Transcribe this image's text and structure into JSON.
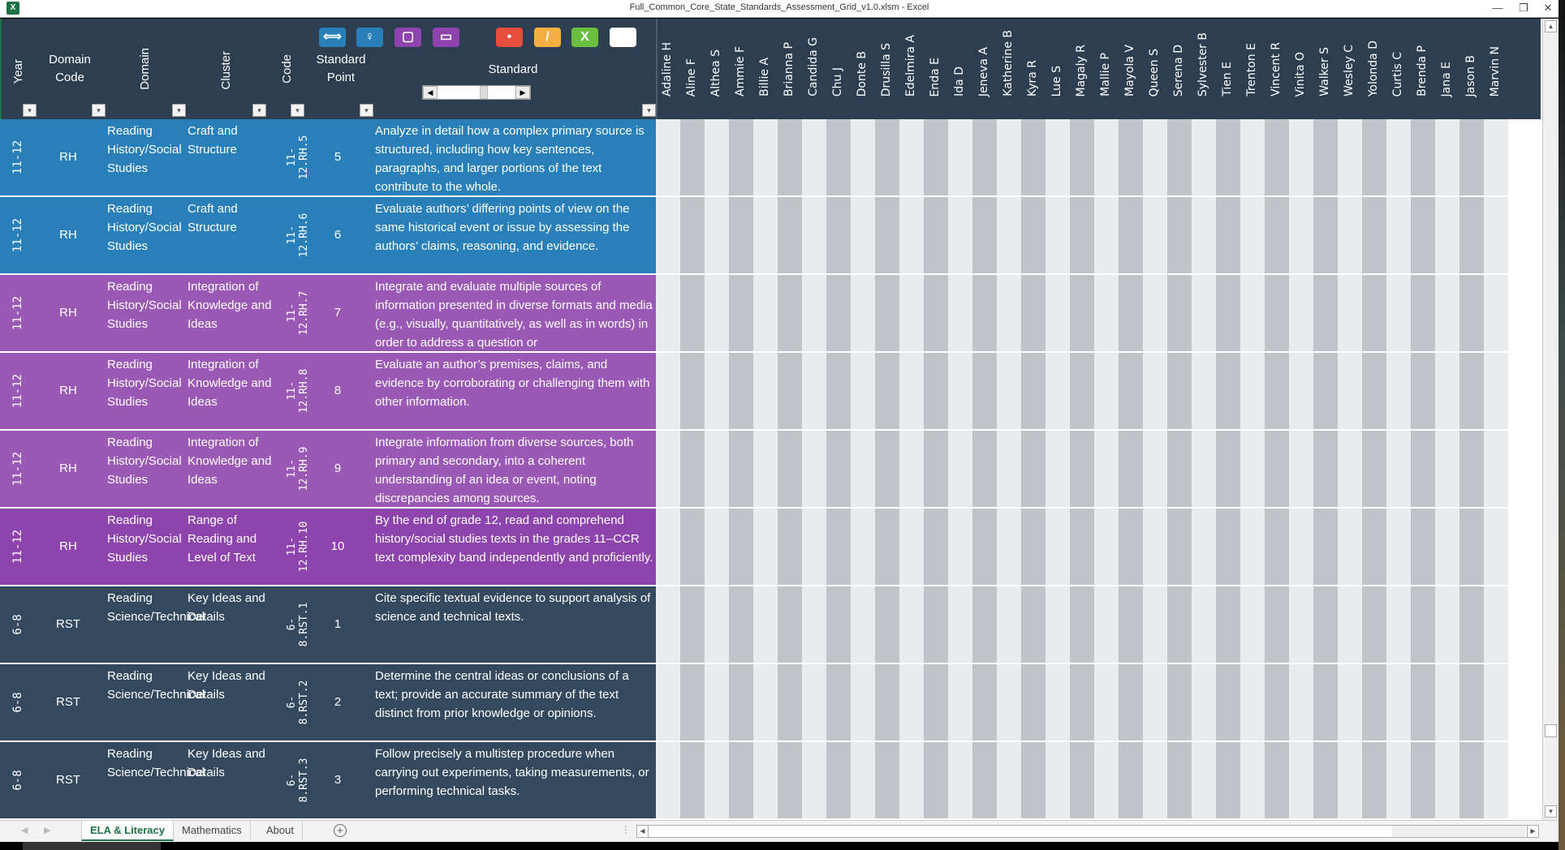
{
  "window": {
    "app_icon": "excel-icon",
    "title": "Full_Common_Core_State_Standards_Assessment_Grid_v1.0.xlsm - Excel",
    "minimize": "—",
    "restore": "❐",
    "close": "✕"
  },
  "header": {
    "year": "Year",
    "domain_code_line1": "Domain",
    "domain_code_line2": "Code",
    "domain": "Domain",
    "cluster": "Cluster",
    "code": "Code",
    "standard_point_line1": "Standard",
    "standard_point_line2": "Point",
    "standard": "Standard",
    "filter_glyph": "▾",
    "toolbar": [
      {
        "name": "expand-columns-icon",
        "glyph": "⟺",
        "color": "#2980b9"
      },
      {
        "name": "key-icon",
        "glyph": "♀",
        "color": "#2980b9"
      },
      {
        "name": "rounded-square-icon",
        "glyph": "▢",
        "color": "#8e44ad"
      },
      {
        "name": "window-icon",
        "glyph": "▭",
        "color": "#8e44ad"
      },
      {
        "name": "dot-mark-icon",
        "glyph": "•",
        "color": "#e74c3c"
      },
      {
        "name": "slash-mark-icon",
        "glyph": "/",
        "color": "#f5b041"
      },
      {
        "name": "x-mark-icon",
        "glyph": "X",
        "color": "#6abf40"
      },
      {
        "name": "blank-mark-icon",
        "glyph": "",
        "color": "#ffffff"
      }
    ],
    "scroll_left": "◀",
    "scroll_right": "▶"
  },
  "students": [
    "Adaline H",
    "Aline F",
    "Althea S",
    "Ammie F",
    "Billie A",
    "Brianna P",
    "Candida G",
    "Chu J",
    "Donte B",
    "Drusilla S",
    "Edelmira A",
    "Enda E",
    "Ida D",
    "Jeneva A",
    "Katherine B",
    "Kyra R",
    "Lue S",
    "Magaly R",
    "Mallie P",
    "Mayola V",
    "Queen S",
    "Serena D",
    "Sylvester B",
    "Tien E",
    "Trenton E",
    "Vincent R",
    "Vinita O",
    "Walker S",
    "Wesley C",
    "Yolonda D",
    "Curtis C",
    "Brenda P",
    "Jana E",
    "Jason B",
    "Marvin N"
  ],
  "rows": [
    {
      "year": "11-12",
      "domain_code": "RH",
      "domain": "Reading History/Social Studies",
      "cluster": "Craft and Structure",
      "code": "11-12.RH.5",
      "point": "5",
      "standard": "Analyze in detail how a complex primary source is structured, including how key sentences, paragraphs, and larger portions of the text contribute to the whole.",
      "color": "blue"
    },
    {
      "year": "11-12",
      "domain_code": "RH",
      "domain": "Reading History/Social Studies",
      "cluster": "Craft and Structure",
      "code": "11-12.RH.6",
      "point": "6",
      "standard": "Evaluate authors’ differing points of view on the same historical event or issue by assessing the authors’ claims, reasoning, and evidence.",
      "color": "blue"
    },
    {
      "year": "11-12",
      "domain_code": "RH",
      "domain": "Reading History/Social Studies",
      "cluster": "Integration of Knowledge and Ideas",
      "code": "11-12.RH.7",
      "point": "7",
      "standard": "Integrate and evaluate multiple sources of information presented in diverse formats and media (e.g., visually, quantitatively, as well as in words) in order to address a question or",
      "color": "purple1"
    },
    {
      "year": "11-12",
      "domain_code": "RH",
      "domain": "Reading History/Social Studies",
      "cluster": "Integration of Knowledge and Ideas",
      "code": "11-12.RH.8",
      "point": "8",
      "standard": "Evaluate an author’s premises, claims, and evidence by corroborating or challenging them with other information.",
      "color": "purple1"
    },
    {
      "year": "11-12",
      "domain_code": "RH",
      "domain": "Reading History/Social Studies",
      "cluster": "Integration of Knowledge and Ideas",
      "code": "11-12.RH.9",
      "point": "9",
      "standard": "Integrate information from diverse sources, both primary and secondary, into a coherent understanding of an idea or event, noting discrepancies among sources.",
      "color": "purple1"
    },
    {
      "year": "11-12",
      "domain_code": "RH",
      "domain": "Reading History/Social Studies",
      "cluster": "Range of Reading and Level of Text",
      "code": "11-12.RH.10",
      "point": "10",
      "standard": "By the end of grade 12, read and comprehend history/social studies texts in the grades 11–CCR text complexity band independently and proficiently.",
      "color": "purple2"
    },
    {
      "year": "6-8",
      "domain_code": "RST",
      "domain": "Reading Science/Technical",
      "cluster": "Key Ideas and Details",
      "code": "6-8.RST.1",
      "point": "1",
      "standard": "Cite specific textual evidence to support analysis of science and technical texts.",
      "color": "navy"
    },
    {
      "year": "6-8",
      "domain_code": "RST",
      "domain": "Reading Science/Technical",
      "cluster": "Key Ideas and Details",
      "code": "6-8.RST.2",
      "point": "2",
      "standard": "Determine the central ideas or conclusions of a text; provide an accurate summary of the text distinct from prior knowledge or opinions.",
      "color": "navy"
    },
    {
      "year": "6-8",
      "domain_code": "RST",
      "domain": "Reading Science/Technical",
      "cluster": "Key Ideas and Details",
      "code": "6-8.RST.3",
      "point": "3",
      "standard": "Follow precisely a multistep procedure when carrying out experiments, taking measurements, or performing technical tasks.",
      "color": "navy"
    }
  ],
  "tabs": {
    "prev": "◀",
    "next": "▶",
    "sheets": [
      {
        "label": "ELA & Literacy",
        "active": true
      },
      {
        "label": "Mathematics",
        "active": false
      },
      {
        "label": "About",
        "active": false
      }
    ],
    "add_sheet": "+",
    "split": "⋮"
  },
  "scrollbars": {
    "up": "▲",
    "down": "▼",
    "left": "◀",
    "right": "▶"
  }
}
